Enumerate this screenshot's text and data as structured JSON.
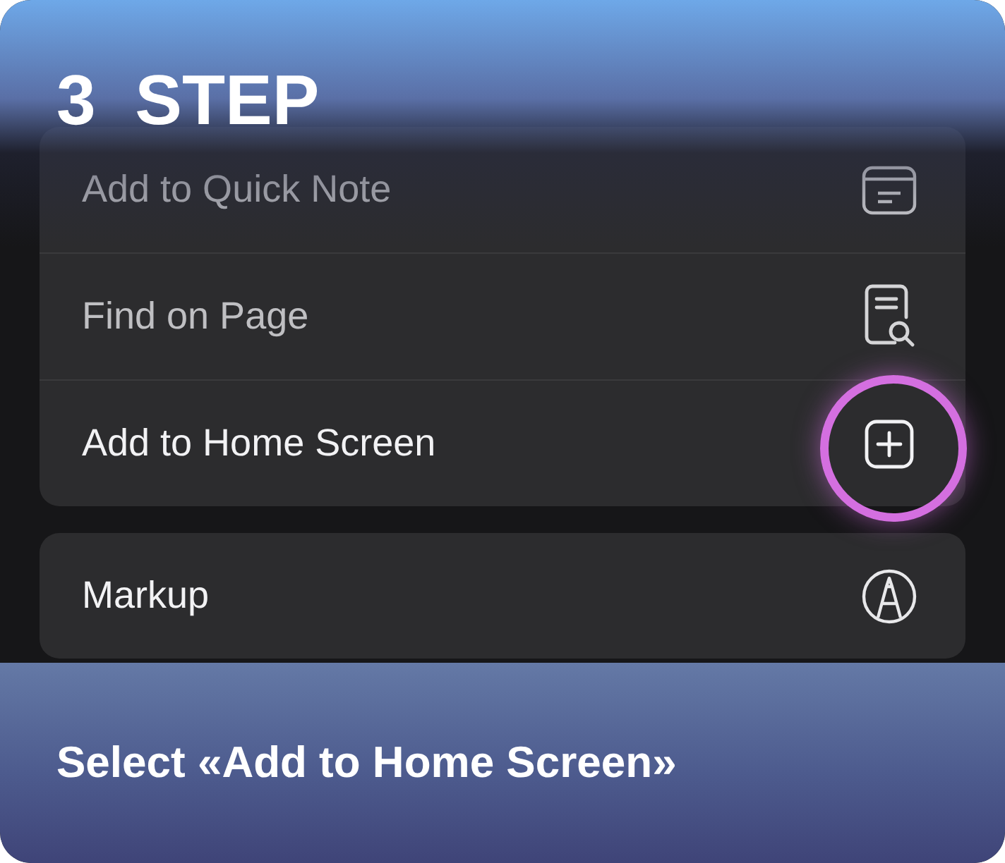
{
  "step_title": "3  STEP",
  "menu_groups": [
    {
      "items": [
        {
          "label": "Add to Quick Note",
          "kind": "quick-note",
          "blurred": true,
          "highlighted": false
        },
        {
          "label": "Find on Page",
          "kind": "find",
          "blurred": true,
          "highlighted": false
        },
        {
          "label": "Add to Home Screen",
          "kind": "add",
          "blurred": false,
          "highlighted": true
        }
      ]
    },
    {
      "items": [
        {
          "label": "Markup",
          "kind": "markup",
          "blurred": false,
          "highlighted": false
        }
      ]
    }
  ],
  "caption": "Select «Add to Home Screen»"
}
